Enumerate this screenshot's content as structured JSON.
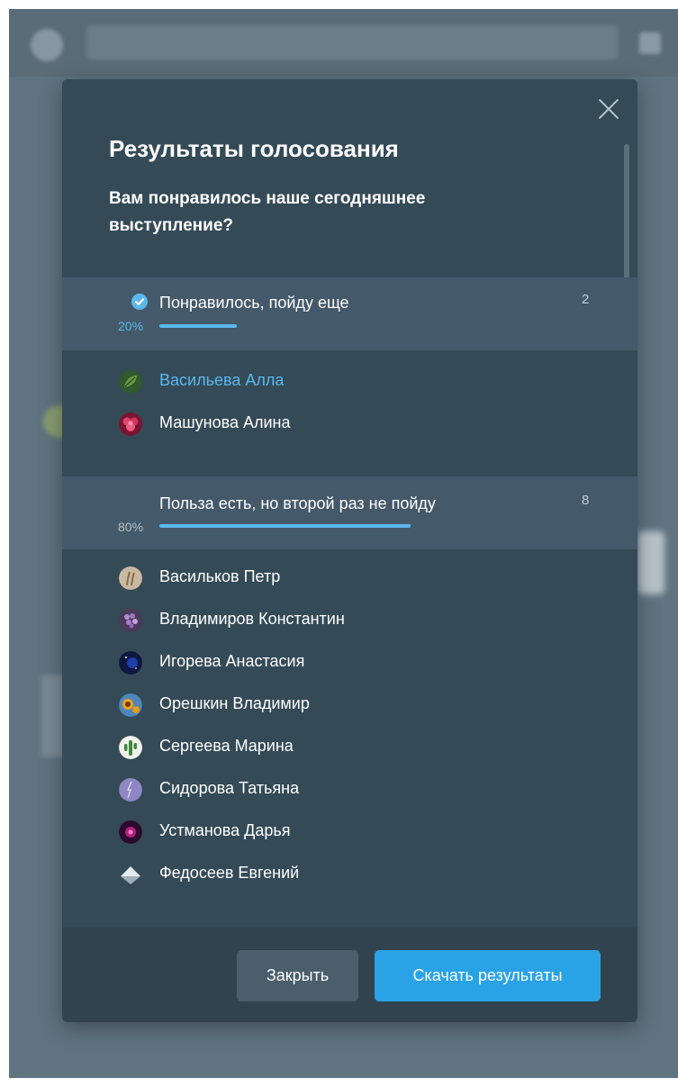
{
  "dialog": {
    "title": "Результаты голосования",
    "question": "Вам понравилось наше сегодняшнее выступление?",
    "options": [
      {
        "label": "Понравилось, пойду еще",
        "count": "2",
        "percent_label": "20%",
        "percent": 20,
        "selected_by_user": true,
        "voters": [
          {
            "name": "Васильева Алла",
            "highlight": true,
            "avatar_icon": "leaf-avatar"
          },
          {
            "name": "Машунова Алина",
            "highlight": false,
            "avatar_icon": "flower-avatar"
          }
        ]
      },
      {
        "label": "Польза есть, но второй раз не пойду",
        "count": "8",
        "percent_label": "80%",
        "percent": 80,
        "selected_by_user": false,
        "voters": [
          {
            "name": "Васильков Петр",
            "avatar_icon": "wheat-avatar"
          },
          {
            "name": "Владимиров Константин",
            "avatar_icon": "lilac-avatar"
          },
          {
            "name": "Игорева Анастасия",
            "avatar_icon": "space-avatar"
          },
          {
            "name": "Орешкин Владимир",
            "avatar_icon": "sunflower-avatar"
          },
          {
            "name": "Сергеева Марина",
            "avatar_icon": "cactus-avatar"
          },
          {
            "name": "Сидорова Татьяна",
            "avatar_icon": "lightning-avatar"
          },
          {
            "name": "Устманова Дарья",
            "avatar_icon": "nebula-avatar"
          },
          {
            "name": "Федосеев Евгений",
            "avatar_icon": "mountain-avatar"
          }
        ]
      }
    ],
    "buttons": {
      "close_label": "Закрыть",
      "download_label": "Скачать результаты"
    }
  },
  "colors": {
    "dialog_bg": "#344a57",
    "option_header_bg": "#44596a",
    "accent": "#5bb8ec",
    "primary_button": "#29a3e5",
    "secondary_button": "#4a5e6b"
  }
}
